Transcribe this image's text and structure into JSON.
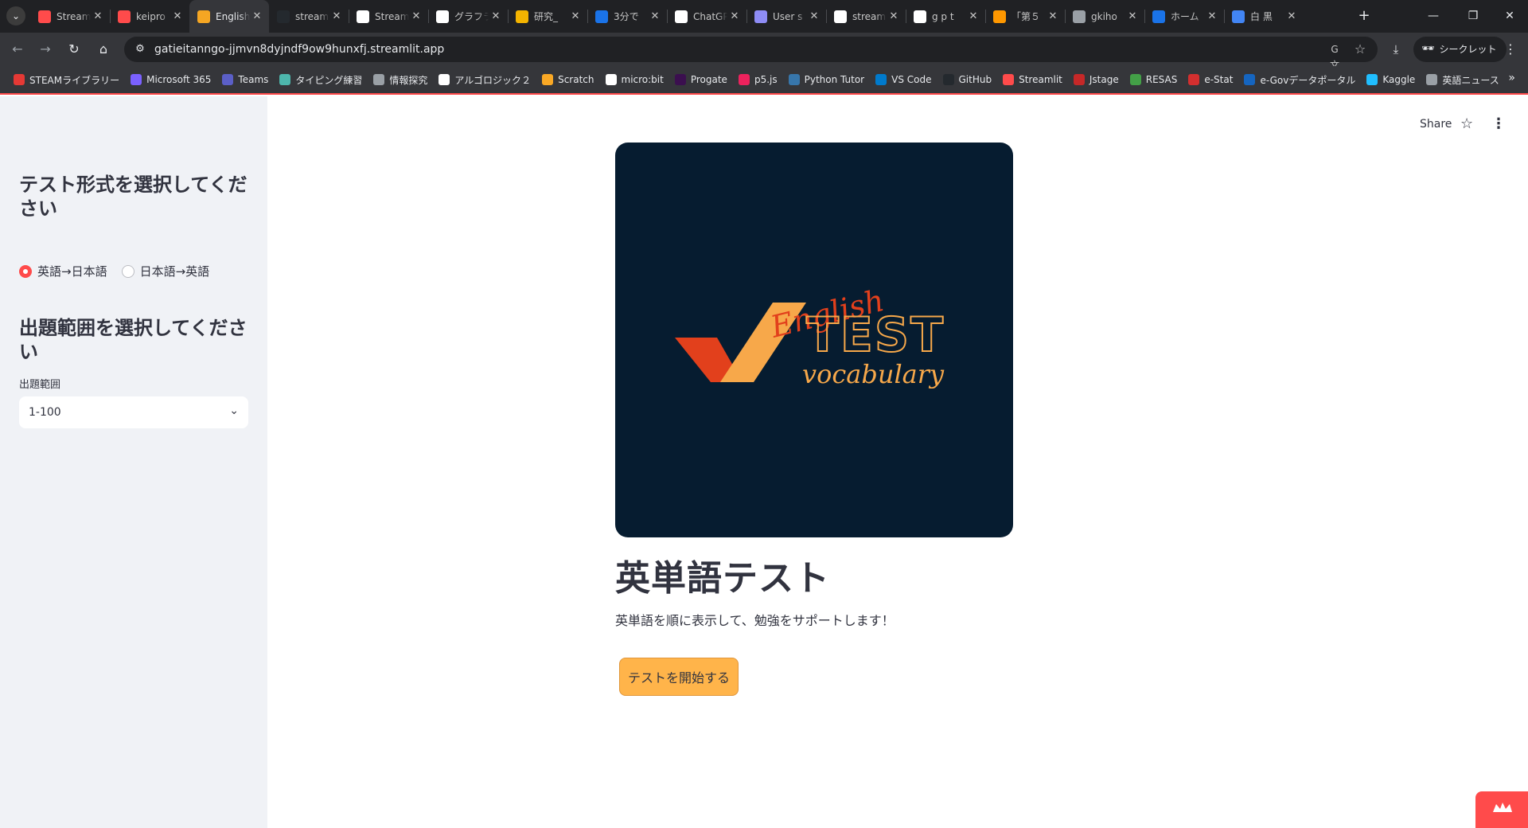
{
  "browser": {
    "tab_list_icon": "chevron-down-icon",
    "tabs": [
      {
        "title": "Streamlit",
        "favicon_color": "#ff4b4b",
        "favicon_icon": "streamlit-crown-icon",
        "active": false
      },
      {
        "title": "keipro",
        "favicon_color": "#ff4b4b",
        "favicon_icon": "crown-icon",
        "active": false
      },
      {
        "title": "English",
        "favicon_color": "#f5a623",
        "favicon_icon": "checkmark-icon",
        "active": true
      },
      {
        "title": "streamlit",
        "favicon_color": "#24292e",
        "favicon_icon": "github-icon",
        "active": false
      },
      {
        "title": "Streamlit",
        "favicon_color": "#ffffff",
        "favicon_icon": "streamlit-crown-icon",
        "active": false
      },
      {
        "title": "グラフラ",
        "favicon_color": "#ffffff",
        "favicon_icon": "openai-icon",
        "active": false
      },
      {
        "title": "研究_",
        "favicon_color": "#f4b400",
        "favicon_icon": "slides-icon",
        "active": false
      },
      {
        "title": "3分で",
        "favicon_color": "#1a73e8",
        "favicon_icon": "site-icon",
        "active": false
      },
      {
        "title": "ChatGPT",
        "favicon_color": "#ffffff",
        "favicon_icon": "openai-icon",
        "active": false
      },
      {
        "title": "User s",
        "favicon_color": "#8e8cf5",
        "favicon_icon": "site-icon",
        "active": false
      },
      {
        "title": "stream",
        "favicon_color": "#ffffff",
        "favicon_icon": "google-icon",
        "active": false
      },
      {
        "title": "g p t",
        "favicon_color": "#ffffff",
        "favicon_icon": "google-icon",
        "active": false
      },
      {
        "title": "「第５",
        "favicon_color": "#ff9800",
        "favicon_icon": "site-icon",
        "active": false
      },
      {
        "title": "gkiho",
        "favicon_color": "#9aa0a6",
        "favicon_icon": "globe-icon",
        "active": false
      },
      {
        "title": "ホーム",
        "favicon_color": "#1a73e8",
        "favicon_icon": "site-icon",
        "active": false
      },
      {
        "title": "白 黒",
        "favicon_color": "#4285f4",
        "favicon_icon": "site-icon",
        "active": false
      }
    ],
    "url": "gatieitanngo-jjmvn8dyjndf9ow9hunxfj.streamlit.app",
    "incognito_label": "シークレット",
    "bookmarks": [
      {
        "label": "STEAMライブラリー",
        "color": "#e53935"
      },
      {
        "label": "Microsoft 365",
        "color": "#7b61ff"
      },
      {
        "label": "Teams",
        "color": "#5b5fc7"
      },
      {
        "label": "タイピング練習",
        "color": "#4db6ac"
      },
      {
        "label": "情報探究",
        "color": "#9aa0a6"
      },
      {
        "label": "アルゴロジック２",
        "color": "#ffffff"
      },
      {
        "label": "Scratch",
        "color": "#f9a825"
      },
      {
        "label": "micro:bit",
        "color": "#ffffff"
      },
      {
        "label": "Progate",
        "color": "#3b0f4f"
      },
      {
        "label": "p5.js",
        "color": "#ed225d"
      },
      {
        "label": "Python Tutor",
        "color": "#3776ab"
      },
      {
        "label": "VS Code",
        "color": "#007acc"
      },
      {
        "label": "GitHub",
        "color": "#24292e"
      },
      {
        "label": "Streamlit",
        "color": "#ff4b4b"
      },
      {
        "label": "Jstage",
        "color": "#c62828"
      },
      {
        "label": "RESAS",
        "color": "#43a047"
      },
      {
        "label": "e-Stat",
        "color": "#d32f2f"
      },
      {
        "label": "e-Govデータポータル",
        "color": "#1565c0"
      },
      {
        "label": "Kaggle",
        "color": "#20beff"
      },
      {
        "label": "英語ニュース",
        "color": "#9aa0a6"
      }
    ]
  },
  "app": {
    "sidebar": {
      "test_format_heading": "テスト形式を選択してください",
      "radio_options": [
        {
          "label": "英語→日本語",
          "selected": true
        },
        {
          "label": "日本語→英語",
          "selected": false
        }
      ],
      "range_heading": "出題範囲を選択してください",
      "range_label": "出題範囲",
      "range_value": "1-100"
    },
    "header": {
      "share_label": "Share"
    },
    "hero": {
      "word_english": "English",
      "word_test": "TEST",
      "word_vocabulary": "vocabulary"
    },
    "title": "英単語テスト",
    "subtitle": "英単語を順に表示して、勉強をサポートします！",
    "start_button": "テストを開始する",
    "colors": {
      "accent": "#ff4b4b",
      "button": "#ffb44a",
      "hero_bg": "#061c30",
      "logo_orange": "#f7a84a",
      "logo_red": "#e2401c"
    }
  }
}
